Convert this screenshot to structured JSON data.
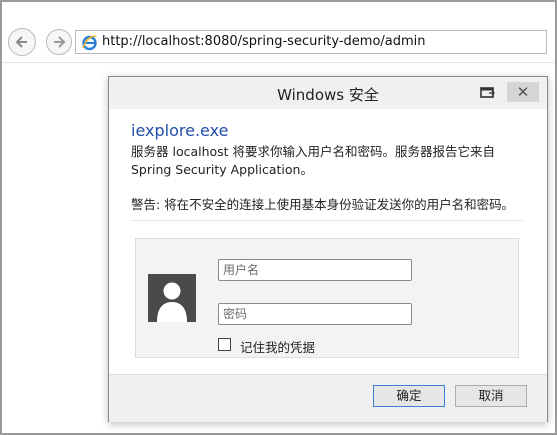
{
  "browser": {
    "url": "http://localhost:8080/spring-security-demo/admin"
  },
  "dialog": {
    "title": "Windows 安全",
    "close_glyph": "✕",
    "app_name": "iexplore.exe",
    "message": "服务器 localhost 将要求你输入用户名和密码。服务器报告它来自 Spring Security Application。",
    "warning": "警告: 将在不安全的连接上使用基本身份验证发送你的用户名和密码。",
    "username_placeholder": "用户名",
    "password_placeholder": "密码",
    "remember_label": "记住我的凭据",
    "ok_label": "确定",
    "cancel_label": "取消"
  },
  "icons": {
    "back": "arrow-left",
    "forward": "arrow-right",
    "page": "internet-explorer",
    "restore": "restore-window",
    "close": "close",
    "user": "user-silhouette"
  },
  "colors": {
    "app_name": "#1f4faa",
    "default_button_border": "#3c7fd4",
    "avatar_bg": "#4a4a4a"
  }
}
